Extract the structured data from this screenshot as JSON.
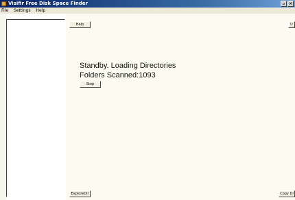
{
  "window": {
    "title": "Visifir Free Disk Space Finder"
  },
  "menu": {
    "items": [
      "File",
      "Settings",
      "Help"
    ]
  },
  "buttons": {
    "help": "Help",
    "top_right": "U",
    "stop": "Stop",
    "explore_dir": "ExploreDir",
    "copy_dir": "Copy Di"
  },
  "status": {
    "line1": "Standby. Loading Directories",
    "line2": "Folders Scanned:1093"
  }
}
